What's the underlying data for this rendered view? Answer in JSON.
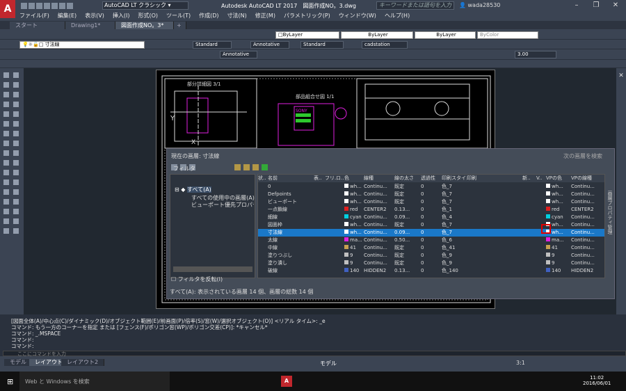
{
  "app": {
    "title": "Autodesk AutoCAD LT 2017　図面作成NO。3.dwg",
    "workspace": "AutoCAD LT クラシック",
    "search_placeholder": "キーワードまたは語句を入力",
    "user": "wada28530"
  },
  "menu": [
    "ファイル(F)",
    "編集(E)",
    "表示(V)",
    "挿入(I)",
    "形式(O)",
    "ツール(T)",
    "作成(D)",
    "寸法(N)",
    "修正(M)",
    "パラメトリック(P)",
    "ウィンドウ(W)",
    "ヘルプ(H)"
  ],
  "tabs": [
    "スタート",
    "Drawing1*",
    "図面作成NO。3*"
  ],
  "toolbar": {
    "layer_current": "寸法線",
    "bylayer1": "ByLayer",
    "bylayer2": "ByLayer",
    "bylayer3": "ByLayer",
    "bycolor": "ByColor",
    "text_style": "Standard",
    "dim_style": "Annotative",
    "table_style": "Standard",
    "mleader_style": "cadstation",
    "annotative": "Annotative",
    "scale_value": "3.00"
  },
  "layer_panel": {
    "current_layer": "現在の画層: 寸法線",
    "search": "次の画層を検索",
    "filter_label": "フィルタ",
    "filters": [
      "すべて(A)",
      "すべての使用中の画層(A)",
      "ビューポート優先プロパティを含む画層"
    ],
    "invert_filter": "フィルタを反転(I)",
    "footer": "すべて(A): 表示されている画層 14 個、画層の総数 14 個",
    "side_label": "画層プロパティ管理",
    "columns": [
      "状..",
      "名前",
      "表..",
      "フリ..",
      "ロ..",
      "色",
      "線種",
      "線の太さ",
      "透過性",
      "印刷スタイル",
      "印刷",
      "新..",
      "V..",
      "VPの色",
      "VPの線種"
    ],
    "rows": [
      {
        "name": "0",
        "color": "wh...",
        "ltype": "Continu...",
        "lw": "既定",
        "tr": "0",
        "ps": "色_7",
        "vpc": "wh...",
        "vpl": "Continu...",
        "swatch": "#ffffff"
      },
      {
        "name": "Defpoints",
        "color": "wh...",
        "ltype": "Continu...",
        "lw": "既定",
        "tr": "0",
        "ps": "色_7",
        "vpc": "wh...",
        "vpl": "Continu...",
        "swatch": "#ffffff"
      },
      {
        "name": "ビューポート",
        "color": "wh...",
        "ltype": "Continu...",
        "lw": "既定",
        "tr": "0",
        "ps": "色_7",
        "vpc": "wh...",
        "vpl": "Continu...",
        "swatch": "#ffffff"
      },
      {
        "name": "一点鎖線",
        "color": "red",
        "ltype": "CENTER2",
        "lw": "0.13...",
        "tr": "0",
        "ps": "色_1",
        "vpc": "red",
        "vpl": "CENTER2",
        "swatch": "#e02020"
      },
      {
        "name": "細線",
        "color": "cyan",
        "ltype": "Continu...",
        "lw": "0.09...",
        "tr": "0",
        "ps": "色_4",
        "vpc": "cyan",
        "vpl": "Continu...",
        "swatch": "#00d0e0"
      },
      {
        "name": "図面枠",
        "color": "wh...",
        "ltype": "Continu...",
        "lw": "既定",
        "tr": "0",
        "ps": "色_7",
        "vpc": "wh...",
        "vpl": "Continu...",
        "swatch": "#ffffff"
      },
      {
        "name": "寸法線",
        "color": "wh...",
        "ltype": "Continu...",
        "lw": "0.09...",
        "tr": "0",
        "ps": "色_7",
        "vpc": "wh...",
        "vpl": "Continu...",
        "swatch": "#ffffff"
      },
      {
        "name": "太線",
        "color": "ma...",
        "ltype": "Continu...",
        "lw": "0.50...",
        "tr": "0",
        "ps": "色_6",
        "vpc": "ma...",
        "vpl": "Continu...",
        "swatch": "#e020e0"
      },
      {
        "name": "中線",
        "color": "41",
        "ltype": "Continu...",
        "lw": "既定",
        "tr": "0",
        "ps": "色_41",
        "vpc": "41",
        "vpl": "Continu...",
        "swatch": "#c8a050"
      },
      {
        "name": "塗りつぶし",
        "color": "9",
        "ltype": "Continu...",
        "lw": "既定",
        "tr": "0",
        "ps": "色_9",
        "vpc": "9",
        "vpl": "Continu...",
        "swatch": "#c0c0c0"
      },
      {
        "name": "塗り潰し",
        "color": "9",
        "ltype": "Continu...",
        "lw": "既定",
        "tr": "0",
        "ps": "色_9",
        "vpc": "9",
        "vpl": "Continu...",
        "swatch": "#c0c0c0"
      },
      {
        "name": "破線",
        "color": "140",
        "ltype": "HIDDEN2",
        "lw": "0.13...",
        "tr": "0",
        "ps": "色_140",
        "vpc": "140",
        "vpl": "HIDDEN2",
        "swatch": "#4060c0"
      }
    ]
  },
  "drawing": {
    "title1": "部分詳細図 3/1",
    "title2": "部品組合せ図 1/1",
    "label_y": "Y",
    "label_x": "X",
    "logo_text": "SONY"
  },
  "command": {
    "lines": [
      "[図面全体(A)/中心点(C)/ダイナミック(D)/オブジェクト範囲(E)/前画面(P)/倍率(S)/窓(W)/選択オブジェクト(O)] <リアル タイム>: _e",
      "コマンド: もう一方のコーナーを指定 または [フェンス(F)/ポリゴン窓(WP)/ポリゴン交差(CP)]: *キャンセル*",
      "コマンド: _.MSPACE",
      "コマンド:",
      "コマンド:"
    ],
    "prompt": "ここにコマンドを入力"
  },
  "layout_tabs": [
    "モデル",
    "レイアウト1",
    "レイアウト2"
  ],
  "status": {
    "model": "モデル",
    "scale": "3:1"
  },
  "taskbar": {
    "search": "Web と Windows を検索",
    "time": "11:02",
    "date": "2016/06/01"
  }
}
